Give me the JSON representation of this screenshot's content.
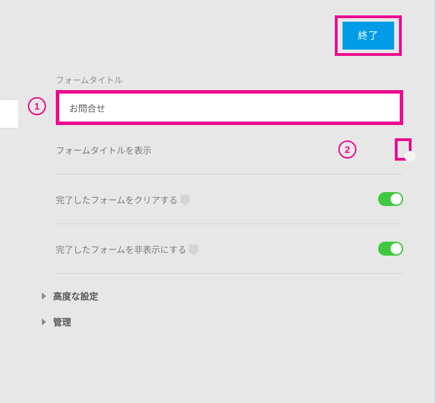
{
  "colors": {
    "accent": "#ec0a8f",
    "primary_button": "#009de6",
    "toggle_on": "#40c940"
  },
  "annotations": {
    "badge1": "1",
    "badge2": "2"
  },
  "finish_button": {
    "label": "終了"
  },
  "form_title_section": {
    "label": "フォームタイトル",
    "value": "お問合せ"
  },
  "rows": {
    "show_title": {
      "label": "フォームタイトルを表示",
      "on": false
    },
    "clear_done": {
      "label": "完了したフォームをクリアする",
      "on": true
    },
    "hide_done": {
      "label": "完了したフォームを非表示にする",
      "on": true
    }
  },
  "expanders": {
    "advanced": "高度な設定",
    "admin": "管理"
  }
}
